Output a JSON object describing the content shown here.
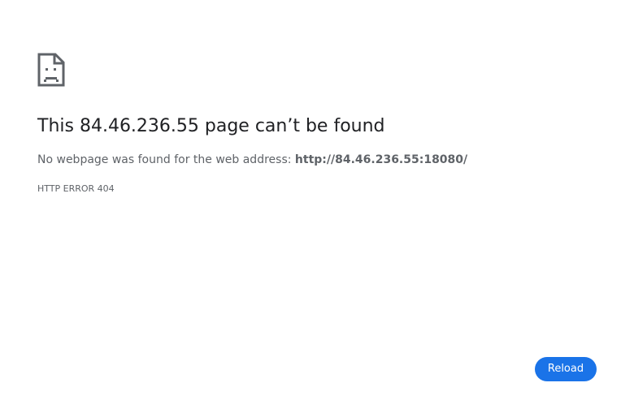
{
  "error": {
    "icon": "sad-page-icon",
    "title_prefix": "This ",
    "title_host": "84.46.236.55",
    "title_suffix": " page can’t be found",
    "description_prefix": "No webpage was found for the web address: ",
    "description_url": "http://84.46.236.55:18080/",
    "code": "HTTP ERROR 404"
  },
  "actions": {
    "reload_label": "Reload"
  },
  "colors": {
    "accent": "#1a73e8",
    "text_primary": "#202124",
    "text_secondary": "#5f6368",
    "icon_stroke": "#5f6368"
  }
}
